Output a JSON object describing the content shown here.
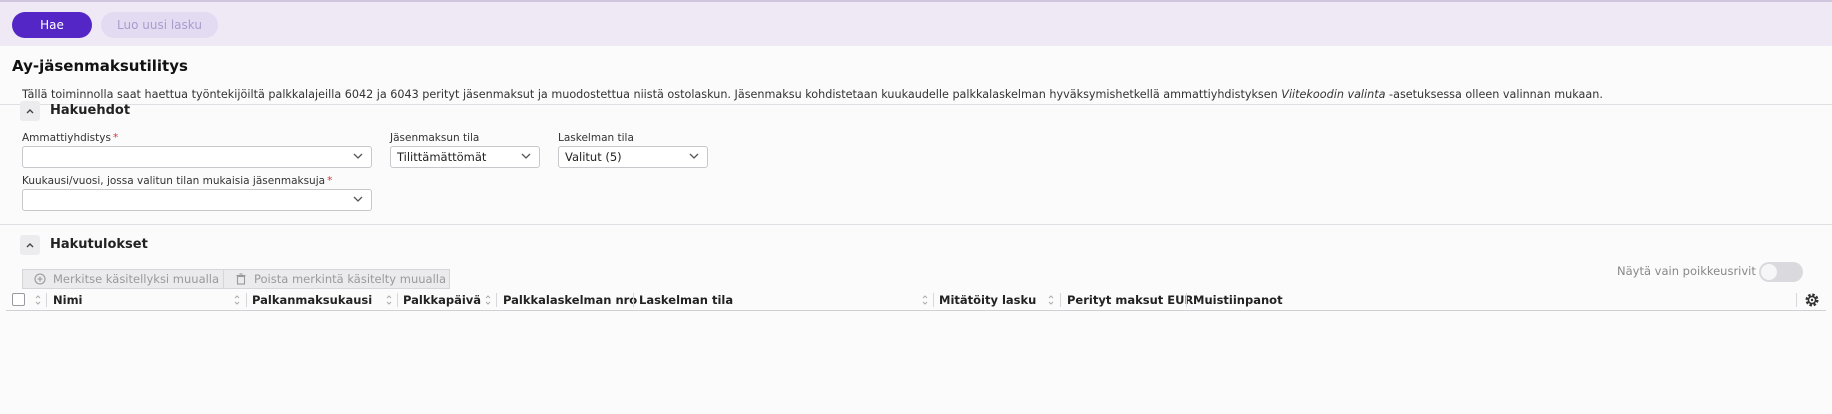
{
  "toolbar": {
    "search_label": "Hae",
    "new_invoice_label": "Luo uusi lasku"
  },
  "page": {
    "title": "Ay-jäsenmaksutilitys",
    "description_part1": "Tällä toiminnolla saat haettua työntekijöiltä palkkalajeilla 6042 ja 6043 perityt jäsenmaksut ja muodostettua niistä ostolaskun. Jäsenmaksu kohdistetaan kuukaudelle palkkalaskelman hyväksymishetkellä ammattiyhdistyksen ",
    "description_em": "Viitekoodin valinta",
    "description_part2": " -asetuksessa olleen valinnan mukaan."
  },
  "search_criteria": {
    "title": "Hakuehdot",
    "union_label": "Ammattiyhdistys",
    "union_value": "",
    "fee_status_label": "Jäsenmaksun tila",
    "fee_status_value": "Tilittämättömät",
    "calc_status_label": "Laskelman tila",
    "calc_status_value": "Valitut (5)",
    "period_label": "Kuukausi/vuosi, jossa valitun tilan mukaisia jäsenmaksuja",
    "period_value": "",
    "required_mark": "*"
  },
  "results": {
    "title": "Hakutulokset",
    "mark_handled_label": "Merkitse käsitellyksi muualla",
    "unmark_handled_label": "Poista merkintä käsitelty muualla",
    "exceptions_toggle_label": "Näytä vain poikkeusrivit",
    "exceptions_toggle_on": false,
    "columns": [
      "Nimi",
      "Palkanmaksukausi",
      "Palkkapäivä",
      "Palkkalaskelman nro",
      "Laskelman tila",
      "Mitätöity lasku",
      "Perityt maksut EUR",
      "Muistiinpanot"
    ]
  },
  "colors": {
    "primary": "#5526c6",
    "toolbar_bg": "#eee9f5",
    "required": "#dd3333"
  }
}
